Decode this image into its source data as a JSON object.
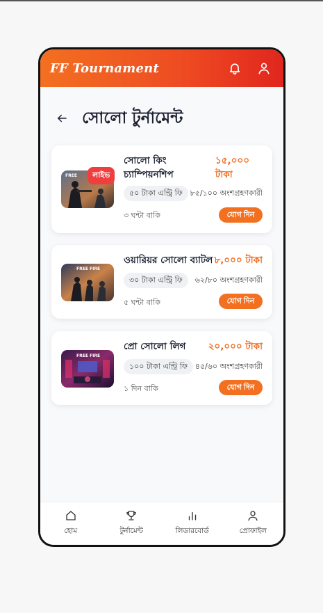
{
  "header": {
    "brand": "FF Tournament"
  },
  "page": {
    "title": "সোলো টুর্নামেন্ট"
  },
  "tournaments": [
    {
      "name_line1": "সোলো কিং",
      "name_line2": "চ্যাম্পিয়নশিপ",
      "prize_line1": "১৫,০০০",
      "prize_line2": "টাকা",
      "fee": "৫০ টাকা এন্ট্রি ফি",
      "slots": "৮৫/১০০ অংশগ্রহণকারী",
      "time_left": "৩ ঘন্টা বাকি",
      "join": "যোগ দিন",
      "badge": "লাইভ"
    },
    {
      "name": "ওয়ারিয়র সোলো ব্যাটল",
      "prize": "৮,০০০ টাকা",
      "fee": "৩০ টাকা এন্ট্রি ফি",
      "slots": "৬২/৮০ অংশগ্রহণকারী",
      "time_left": "৫ ঘন্টা বাকি",
      "join": "যোগ দিন"
    },
    {
      "name": "প্রো সোলো লিগ",
      "prize": "২০,০০০ টাকা",
      "fee": "১০০ টাকা এন্ট্রি ফি",
      "slots": "৪৫/৬০ অংশগ্রহণকারী",
      "time_left": "১ দিন বাকি",
      "join": "যোগ দিন"
    }
  ],
  "nav": {
    "home": "হোম",
    "tournament": "টুর্নামেন্ট",
    "leaderboard": "লিডারবোর্ড",
    "profile": "প্রোফাইল"
  },
  "colors": {
    "accent": "#f37021",
    "live": "#ef3e3e",
    "header_end": "#e0261e"
  }
}
